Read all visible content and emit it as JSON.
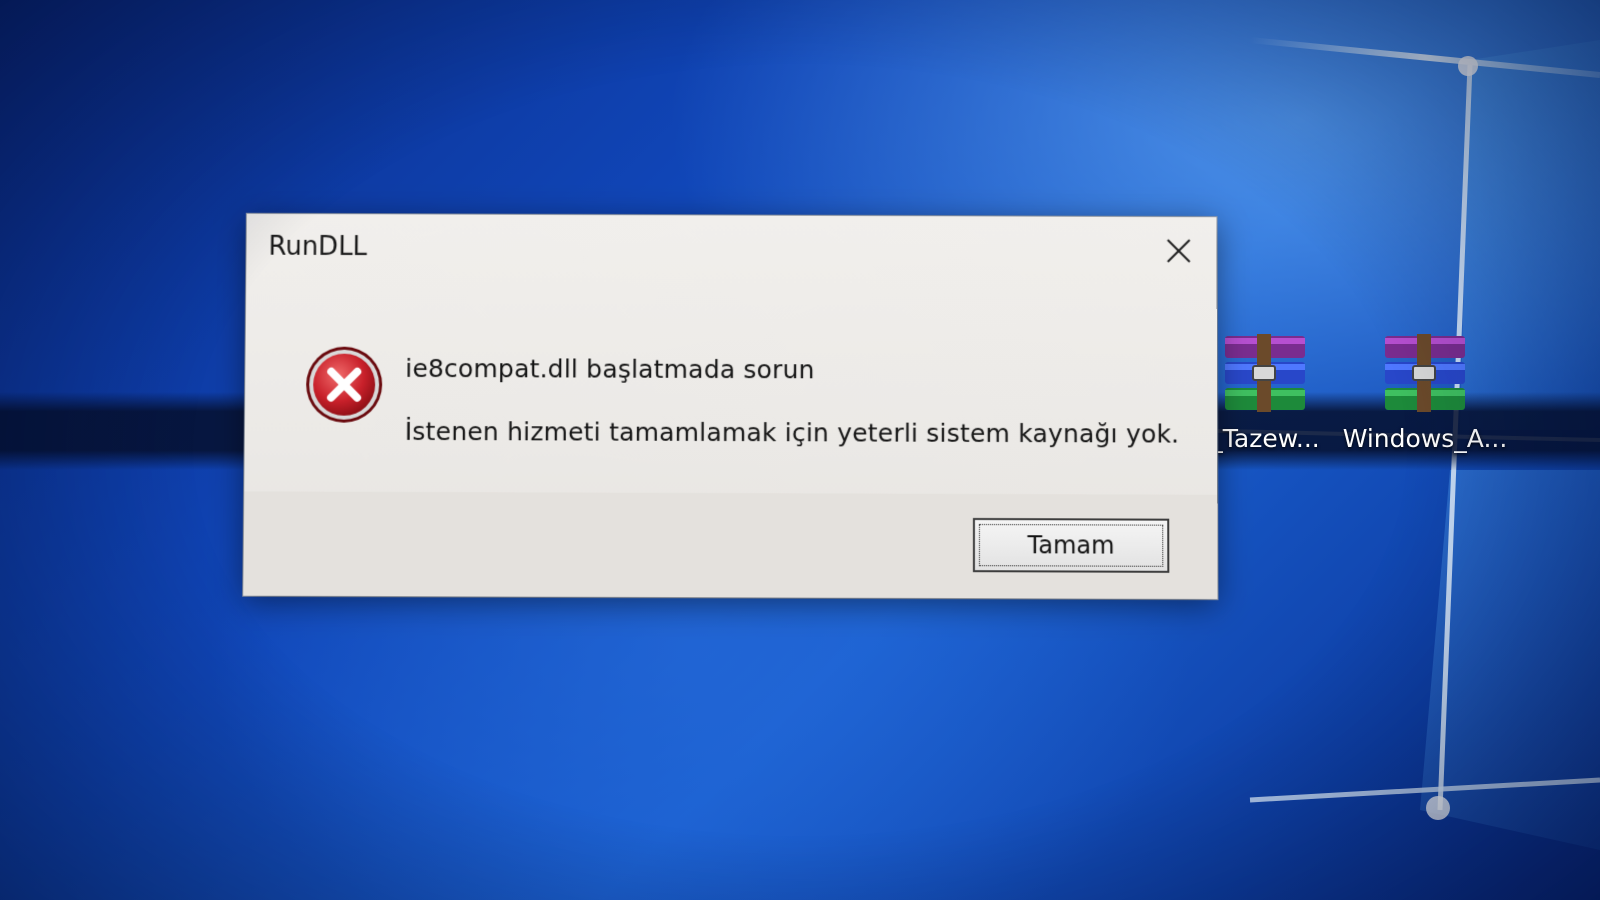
{
  "desktop": {
    "icons": [
      {
        "label": "_Tazew...",
        "icon": "winrar-archive-icon"
      },
      {
        "label": "Windows_A...",
        "icon": "winrar-archive-icon"
      }
    ]
  },
  "dialog": {
    "title": "RunDLL",
    "close_icon": "close-icon",
    "status_icon": "error-icon",
    "message_title": "ie8compat.dll başlatmada sorun",
    "message_body": "İstenen hizmeti tamamlamak için yeterli sistem kaynağı yok.",
    "ok_label": "Tamam"
  },
  "colors": {
    "desktop_blue": "#1046b8",
    "dialog_bg": "#ebe9e6",
    "error_red": "#c8202a"
  }
}
